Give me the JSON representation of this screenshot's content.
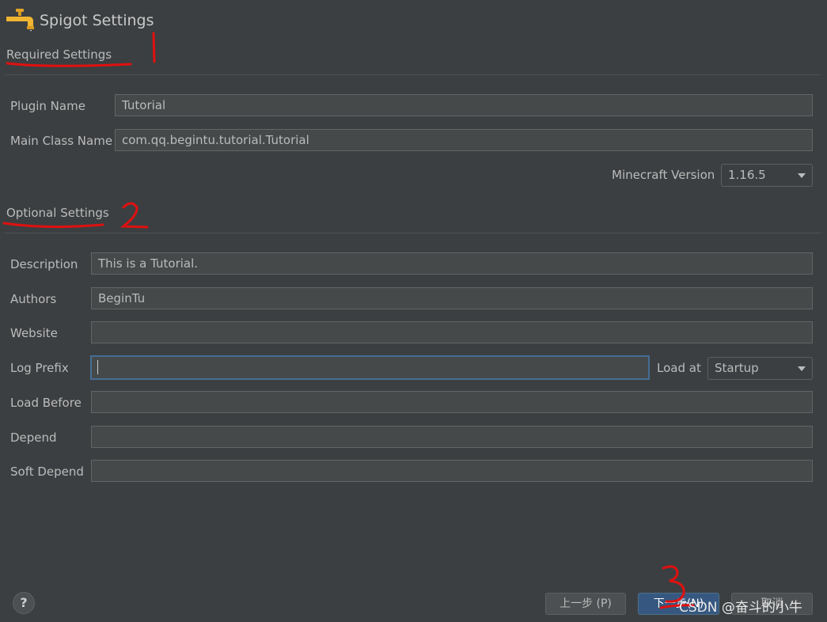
{
  "window": {
    "title": "Spigot Settings",
    "icon": "faucet-icon"
  },
  "required": {
    "heading": "Required Settings",
    "plugin_name_label": "Plugin Name",
    "plugin_name_value": "Tutorial",
    "main_class_label": "Main Class Name",
    "main_class_value": "com.qq.begintu.tutorial.Tutorial",
    "mc_version_label": "Minecraft Version",
    "mc_version_value": "1.16.5"
  },
  "optional": {
    "heading": "Optional Settings",
    "description_label": "Description",
    "description_value": "This is a Tutorial.",
    "authors_label": "Authors",
    "authors_value": "BeginTu",
    "website_label": "Website",
    "website_value": "",
    "log_prefix_label": "Log Prefix",
    "log_prefix_value": "",
    "load_at_label": "Load at",
    "load_at_value": "Startup",
    "load_before_label": "Load Before",
    "load_before_value": "",
    "depend_label": "Depend",
    "depend_value": "",
    "soft_depend_label": "Soft Depend",
    "soft_depend_value": ""
  },
  "footer": {
    "help_label": "?",
    "prev_label": "上一步 (P)",
    "next_label": "下一步(N)",
    "cancel_label": "取消"
  },
  "annotations": {
    "marks": [
      "1",
      "2",
      "3"
    ],
    "color": "#e01010"
  },
  "watermark": "CSDN @奋斗的小牛",
  "colors": {
    "background": "#3c3f41",
    "field_background": "#45494a",
    "focus_border": "#466d94",
    "primary_button": "#365880"
  }
}
